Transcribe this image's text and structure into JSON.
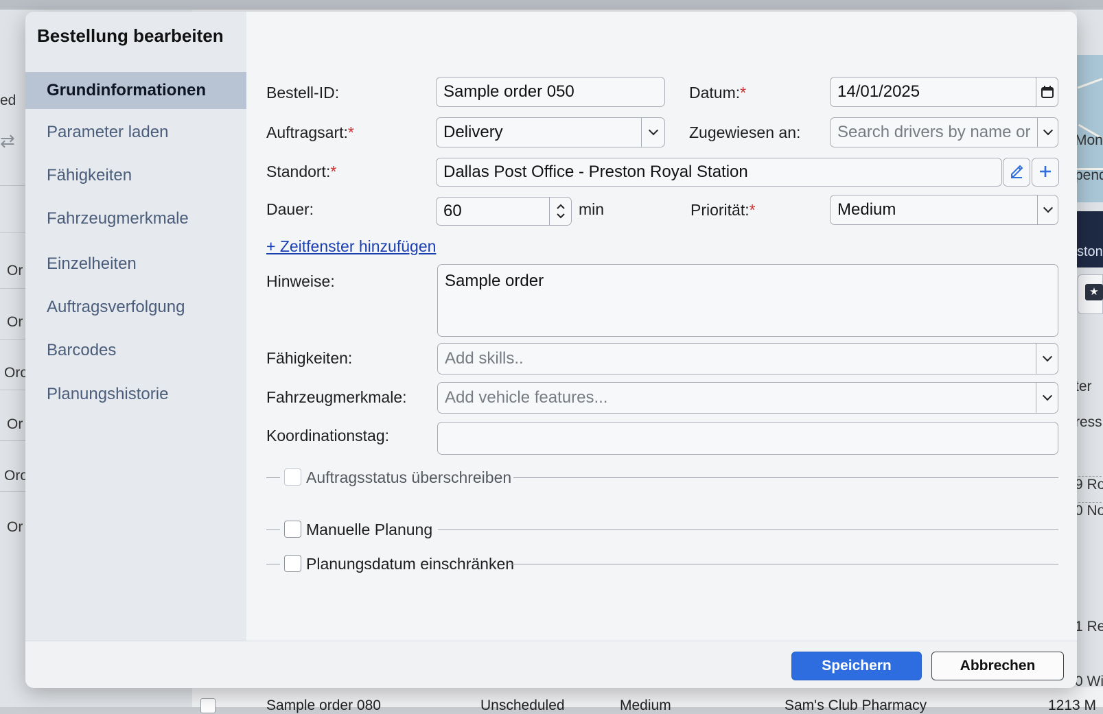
{
  "background": {
    "left_fragments": [
      "ed",
      "Or",
      "Or",
      "Orc",
      "Or",
      "Orc",
      "Or"
    ],
    "right_fragments": [
      "Mont",
      "pend",
      "ston",
      "ter",
      "ress",
      "9 Ro",
      "0 No",
      "1 Re",
      "0 Wi"
    ],
    "bottom_row": {
      "order": "Sample order 080",
      "status": "Unscheduled",
      "priority": "Medium",
      "location": "Sam's Club Pharmacy",
      "address": "1213 M"
    }
  },
  "modal": {
    "title": "Bestellung bearbeiten",
    "sidebar": [
      {
        "label": "Grundinformationen",
        "active": true
      },
      {
        "label": "Parameter laden"
      },
      {
        "label": "Fähigkeiten"
      },
      {
        "label": "Fahrzeugmerkmale"
      },
      {
        "label": "Einzelheiten"
      },
      {
        "label": "Auftragsverfolgung"
      },
      {
        "label": "Barcodes"
      },
      {
        "label": "Planungshistorie"
      }
    ],
    "form": {
      "order_id": {
        "label": "Bestell-ID:",
        "value": "Sample order 050"
      },
      "date": {
        "label": "Datum:",
        "required_mark": "*",
        "value": "14/01/2025"
      },
      "order_type": {
        "label": "Auftragsart:",
        "required_mark": "*",
        "value": "Delivery"
      },
      "assigned_to": {
        "label": "Zugewiesen an:",
        "placeholder": "Search drivers by name or se"
      },
      "location": {
        "label": "Standort:",
        "required_mark": "*",
        "value": "Dallas Post Office - Preston Royal Station"
      },
      "duration": {
        "label": "Dauer:",
        "value": "60",
        "unit": "min"
      },
      "priority": {
        "label": "Priorität:",
        "required_mark": "*",
        "value": "Medium"
      },
      "add_time_window": "+ Zeitfenster hinzufügen",
      "notes": {
        "label": "Hinweise:",
        "value": "Sample order"
      },
      "skills": {
        "label": "Fähigkeiten:",
        "placeholder": "Add skills.."
      },
      "vehicle_features": {
        "label": "Fahrzeugmerkmale:",
        "placeholder": "Add vehicle features..."
      },
      "coordination_day": {
        "label": "Koordinationstag:",
        "value": ""
      },
      "override_status": {
        "label": "Auftragsstatus überschreiben",
        "checked": false
      },
      "manual_planning": {
        "label": "Manuelle Planung",
        "checked": false
      },
      "restrict_date": {
        "label": "Planungsdatum einschränken",
        "checked": false
      }
    },
    "footer": {
      "save": "Speichern",
      "cancel": "Abbrechen"
    }
  },
  "colors": {
    "primary": "#2e6de0",
    "required": "#d0302f",
    "link": "#1a3fb0",
    "sidebar_active": "#b8c4d4"
  }
}
